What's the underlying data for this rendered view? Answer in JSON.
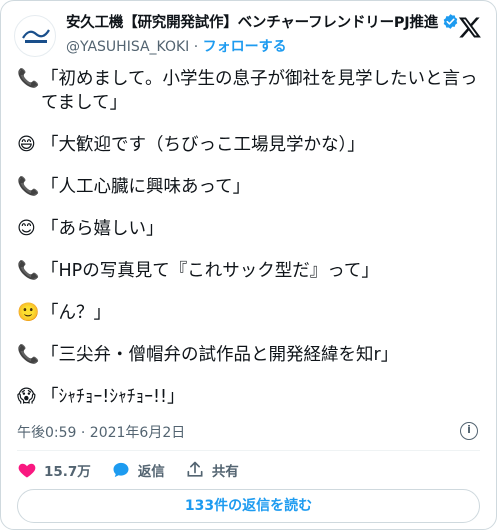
{
  "author": {
    "name": "安久工機【研究開発試作】ベンチャーフレンドリーPJ推進",
    "handle": "@YASUHISA_KOKI",
    "separator": "·",
    "follow_label": "フォローする",
    "avatar_text": "安久工機"
  },
  "tweet": {
    "lines": [
      {
        "icon": "telephone-icon",
        "emoji": "📞",
        "text": "「初めまして。小学生の息子が御社を見学したいと言ってまして」"
      },
      {
        "icon": "grinning-face-icon",
        "emoji": "😄",
        "text": "「大歓迎です（ちびっこ工場見学かな）」"
      },
      {
        "icon": "telephone-icon",
        "emoji": "📞",
        "text": "「人工心臓に興味あって」"
      },
      {
        "icon": "smiling-face-icon",
        "emoji": "😊",
        "text": "「あら嬉しい」"
      },
      {
        "icon": "telephone-icon",
        "emoji": "📞",
        "text": "「HPの写真見て『これサック型だ』って」"
      },
      {
        "icon": "slight-smile-icon",
        "emoji": "🙂",
        "text": "「ん？」"
      },
      {
        "icon": "telephone-icon",
        "emoji": "📞",
        "text": "「三尖弁・僧帽弁の試作品と開発経緯を知r」"
      },
      {
        "icon": "screaming-face-icon",
        "emoji": "😱",
        "text": "「ｼｬﾁｮｰ!ｼｬﾁｮｰ!!」"
      }
    ],
    "timestamp": "午後0:59 · 2021年6月2日"
  },
  "actions": {
    "likes": "15.7万",
    "reply_label": "返信",
    "share_label": "共有",
    "read_replies_label": "133件の返信を読む"
  },
  "colors": {
    "accent": "#1d9bf0",
    "like_red": "#f91880",
    "muted": "#536471"
  }
}
